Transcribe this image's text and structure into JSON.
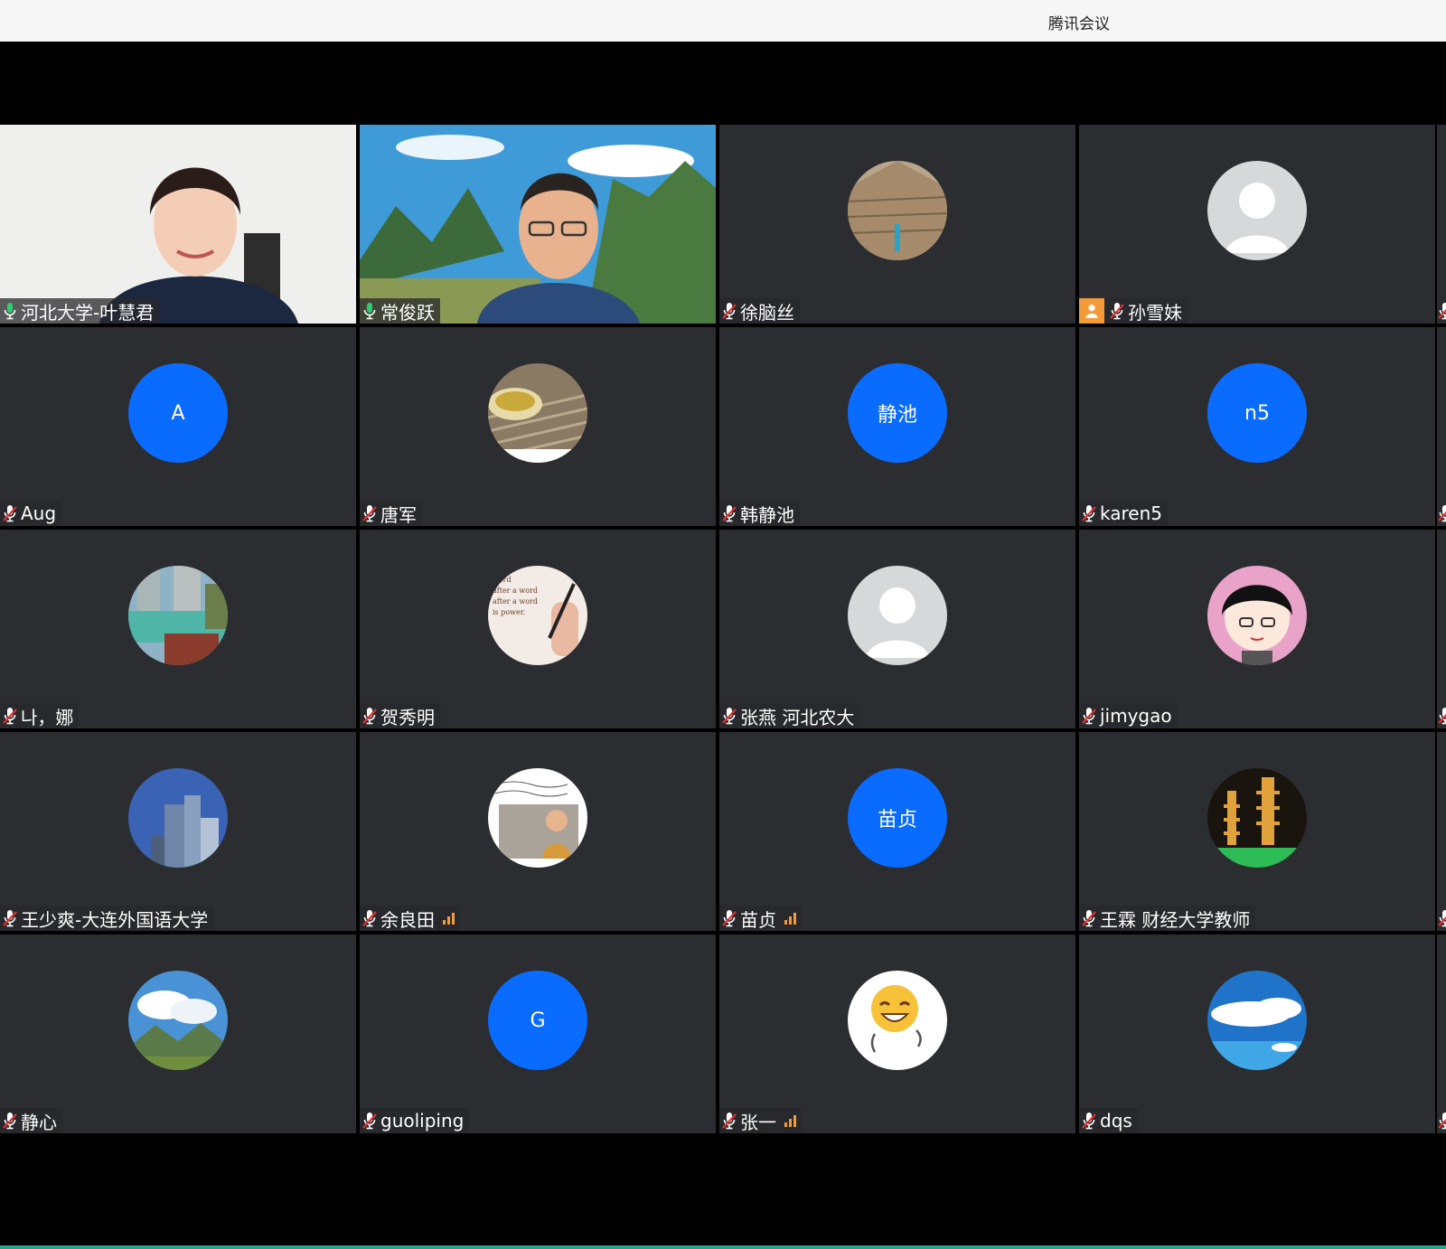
{
  "window": {
    "title": "腾讯会议"
  },
  "participants": [
    {
      "name": "河北大学-叶慧君",
      "avatar": "video-woman",
      "mic": "on",
      "active": true
    },
    {
      "name": "常俊跃",
      "avatar": "video-man-mountains",
      "mic": "on"
    },
    {
      "name": "徐脑丝",
      "avatar": "photo-pyramid",
      "mic": "muted"
    },
    {
      "name": "孙雪妹",
      "avatar": "default-person",
      "mic": "muted",
      "host": true
    },
    {
      "name": "Aug",
      "avatar": "initial",
      "initial": "A",
      "mic": "muted"
    },
    {
      "name": "唐军",
      "avatar": "photo-tea",
      "mic": "muted"
    },
    {
      "name": "韩静池",
      "avatar": "initial",
      "initial": "静池",
      "mic": "muted"
    },
    {
      "name": "karen5",
      "avatar": "initial",
      "initial": "n5",
      "mic": "muted"
    },
    {
      "name": "나，娜",
      "avatar": "photo-lake",
      "mic": "muted"
    },
    {
      "name": "贺秀明",
      "avatar": "photo-writing",
      "mic": "muted"
    },
    {
      "name": "张燕 河北农大",
      "avatar": "default-person",
      "mic": "muted"
    },
    {
      "name": "jimygao",
      "avatar": "cartoon-girl",
      "mic": "muted"
    },
    {
      "name": "王少爽-大连外国语大学",
      "avatar": "photo-buildings",
      "mic": "muted"
    },
    {
      "name": "余良田",
      "avatar": "photo-woman",
      "mic": "muted",
      "signal": true
    },
    {
      "name": "苗贞",
      "avatar": "initial",
      "initial": "苗贞",
      "mic": "muted",
      "signal": true
    },
    {
      "name": "王霖 财经大学教师",
      "avatar": "photo-pagoda",
      "mic": "muted"
    },
    {
      "name": "静心",
      "avatar": "photo-mountain-clouds",
      "mic": "muted"
    },
    {
      "name": "guoliping",
      "avatar": "initial",
      "initial": "G",
      "mic": "muted"
    },
    {
      "name": "张一",
      "avatar": "emoji-smile",
      "mic": "muted",
      "signal": true
    },
    {
      "name": "dqs",
      "avatar": "photo-sky",
      "mic": "muted"
    }
  ],
  "colors": {
    "initialBlue": "#0a6cff",
    "tile": "#2b2d31",
    "accent": "#2ecc71",
    "signal": "#f29b38",
    "mutedRed": "#e03131"
  }
}
